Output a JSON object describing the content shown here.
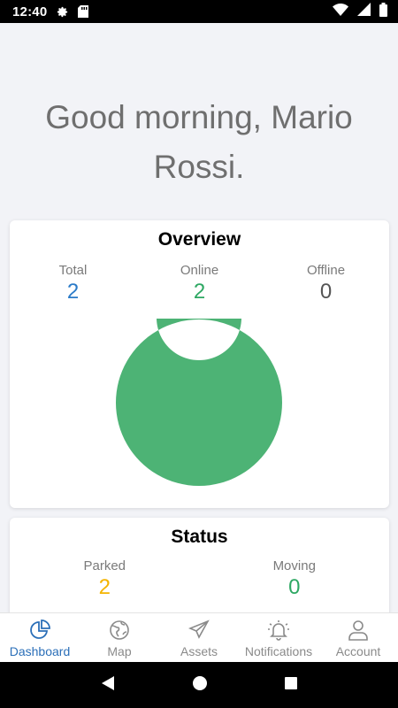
{
  "status_bar": {
    "time": "12:40",
    "icons_left": [
      "gear-icon",
      "sd-card-icon"
    ],
    "icons_right": [
      "wifi-icon",
      "signal-icon",
      "battery-icon"
    ]
  },
  "greeting": "Good morning, Mario Rossi.",
  "overview": {
    "title": "Overview",
    "stats": [
      {
        "label": "Total",
        "value": "2",
        "color": "#2b7bc8"
      },
      {
        "label": "Online",
        "value": "2",
        "color": "#2ea863"
      },
      {
        "label": "Offline",
        "value": "0",
        "color": "#555555"
      }
    ],
    "chart_data": {
      "type": "pie",
      "variant": "donut",
      "title": "",
      "slices": [
        {
          "label": "Online",
          "value": 2,
          "color": "#4db375"
        },
        {
          "label": "Offline",
          "value": 0,
          "color": "#9e9e9e"
        }
      ]
    }
  },
  "status": {
    "title": "Status",
    "stats": [
      {
        "label": "Parked",
        "value": "2",
        "color": "#f4b400"
      },
      {
        "label": "Moving",
        "value": "0",
        "color": "#2ea863"
      }
    ]
  },
  "bottom_nav": {
    "items": [
      {
        "label": "Dashboard",
        "icon": "pie-chart-icon",
        "active": true
      },
      {
        "label": "Map",
        "icon": "globe-icon",
        "active": false
      },
      {
        "label": "Assets",
        "icon": "paper-plane-icon",
        "active": false
      },
      {
        "label": "Notifications",
        "icon": "bell-icon",
        "active": false
      },
      {
        "label": "Account",
        "icon": "user-icon",
        "active": false
      }
    ]
  },
  "system_nav": [
    "back-icon",
    "home-icon",
    "recents-icon"
  ],
  "colors": {
    "accent": "#2b6fb8",
    "donut_green": "#4db375",
    "background": "#f2f3f7"
  }
}
